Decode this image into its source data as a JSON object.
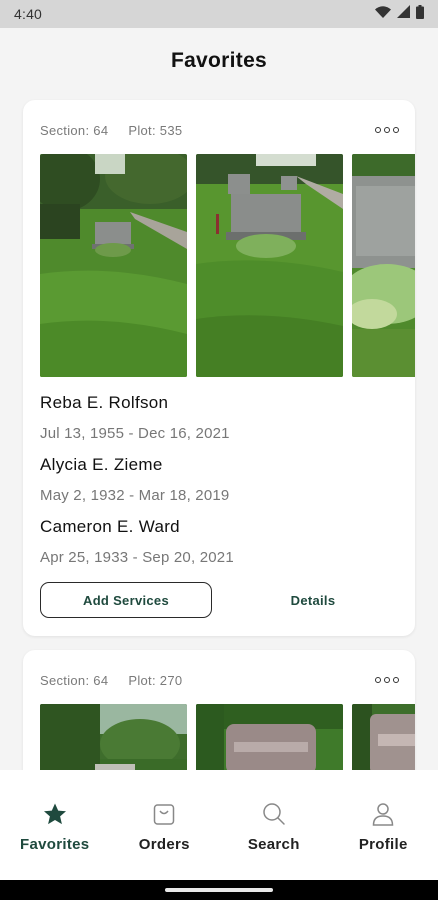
{
  "status_bar": {
    "time": "4:40"
  },
  "header": {
    "title": "Favorites"
  },
  "favorites": [
    {
      "section_label": "Section:  64",
      "plot_label": "Plot:  535",
      "persons": [
        {
          "name": "Reba E. Rolfson",
          "dates": "Jul 13, 1955 - Dec 16, 2021"
        },
        {
          "name": "Alycia E. Zieme",
          "dates": "May 2, 1932 - Mar 18, 2019"
        },
        {
          "name": "Cameron E. Ward",
          "dates": "Apr 25, 1933 - Sep 20, 2021"
        }
      ],
      "add_services_label": "Add Services",
      "details_label": "Details"
    },
    {
      "section_label": "Section:  64",
      "plot_label": "Plot:  270"
    }
  ],
  "bottom_nav": [
    {
      "label": "Favorites",
      "icon": "star-icon",
      "active": true
    },
    {
      "label": "Orders",
      "icon": "shopping-bag-icon",
      "active": false
    },
    {
      "label": "Search",
      "icon": "search-icon",
      "active": false
    },
    {
      "label": "Profile",
      "icon": "person-icon",
      "active": false
    }
  ],
  "colors": {
    "accent": "#1f4a3e",
    "status_bar": "#d6d6d6",
    "background": "#f4f4f4"
  }
}
